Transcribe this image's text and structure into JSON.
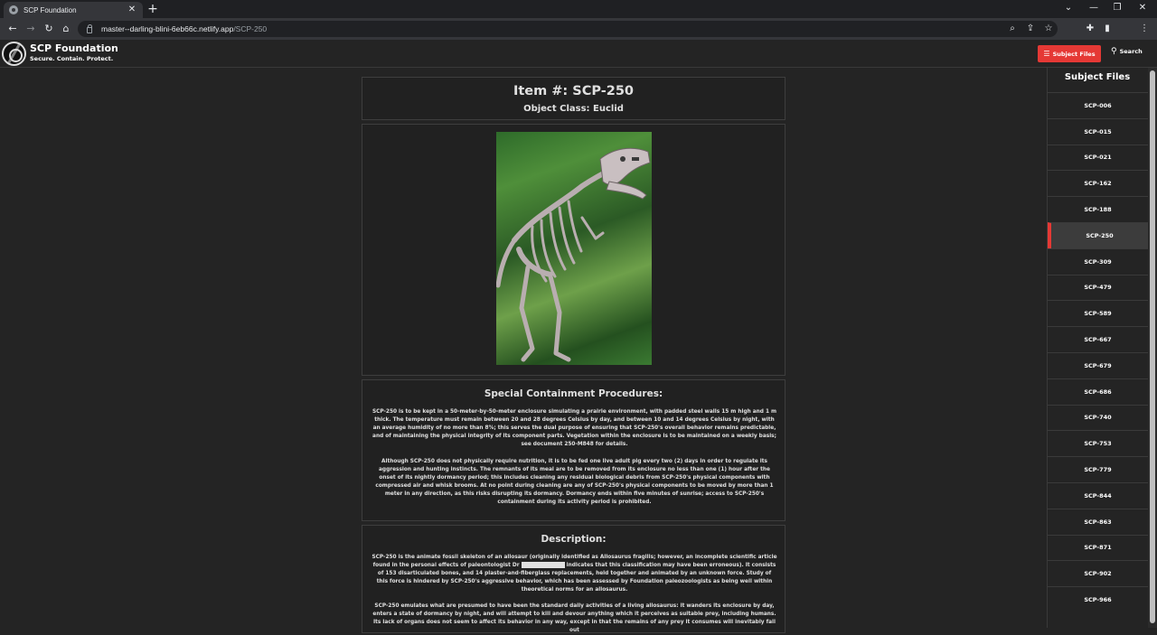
{
  "browser": {
    "tab_title": "SCP Foundation",
    "tab_close": "✕",
    "new_tab": "+",
    "url_host": "master--darling-blini-6eb66c.netlify.app",
    "url_path": "/SCP-250",
    "win_min": "⌄",
    "win_minimize": "—",
    "win_restore": "❐",
    "win_close": "✕"
  },
  "site": {
    "brand_title": "SCP Foundation",
    "brand_tagline": "Secure. Contain. Protect.",
    "subject_files_button": "Subject Files",
    "search_button": "Search"
  },
  "item": {
    "number": "Item #: SCP-250",
    "object_class": "Object Class: Euclid"
  },
  "procedures": {
    "heading": "Special Containment Procedures:",
    "p1": "SCP-250 is to be kept in a 50-meter-by-50-meter enclosure simulating a prairie environment, with padded steel walls 15 m high and 1 m thick. The temperature must remain between 20 and 28 degrees Celsius by day, and between 10 and 14 degrees Celsius by night, with an average humidity of no more than 8%; this serves the dual purpose of ensuring that SCP-250's overall behavior remains predictable, and of maintaining the physical integrity of its component parts. Vegetation within the enclosure is to be maintained on a weekly basis; see document 250-M848 for details.",
    "p2": "Although SCP-250 does not physically require nutrition, it is to be fed one live adult pig every two (2) days in order to regulate its aggression and hunting instincts. The remnants of its meal are to be removed from its enclosure no less than one (1) hour after the onset of its nightly dormancy period; this includes cleaning any residual biological debris from SCP-250's physical components with compressed air and whisk brooms. At no point during cleaning are any of SCP-250's physical components to be moved by more than 1 meter in any direction, as this risks disrupting its dormancy. Dormancy ends within five minutes of sunrise; access to SCP-250's containment during its activity period is prohibited."
  },
  "description": {
    "heading": "Description:",
    "p1_before": "SCP-250 is the animate fossil skeleton of an allosaur (originally identified as Allosaurus fragilis; however, an incomplete scientific article found in the personal effects of paleontologist Dr ",
    "p1_after": " indicates that this classification may have been erroneous). It consists of 153 disarticulated bones, and 14 plaster-and-fiberglass replacements, held together and animated by an unknown force. Study of this force is hindered by SCP-250's aggressive behavior, which has been assessed by Foundation paleozoologists as being well within theoretical norms for an allosaurus.",
    "p2": "SCP-250 emulates what are presumed to have been the standard daily activities of a living allosaurus: it wanders its enclosure by day, enters a state of dormancy by night, and will attempt to kill and devour anything which it perceives as suitable prey, including humans. Its lack of organs does not seem to affect its behavior in any way, except in that the remains of any prey it consumes will inevitably fall out"
  },
  "sidebar": {
    "title": "Subject Files",
    "items": [
      {
        "label": "SCP-006"
      },
      {
        "label": "SCP-015"
      },
      {
        "label": "SCP-021"
      },
      {
        "label": "SCP-162"
      },
      {
        "label": "SCP-188"
      },
      {
        "label": "SCP-250"
      },
      {
        "label": "SCP-309"
      },
      {
        "label": "SCP-479"
      },
      {
        "label": "SCP-589"
      },
      {
        "label": "SCP-667"
      },
      {
        "label": "SCP-679"
      },
      {
        "label": "SCP-686"
      },
      {
        "label": "SCP-740"
      },
      {
        "label": "SCP-753"
      },
      {
        "label": "SCP-779"
      },
      {
        "label": "SCP-844"
      },
      {
        "label": "SCP-863"
      },
      {
        "label": "SCP-871"
      },
      {
        "label": "SCP-902"
      },
      {
        "label": "SCP-966"
      }
    ],
    "active_index": 5
  },
  "colors": {
    "accent": "#e53935",
    "background": "#242424",
    "panel": "#212121"
  }
}
